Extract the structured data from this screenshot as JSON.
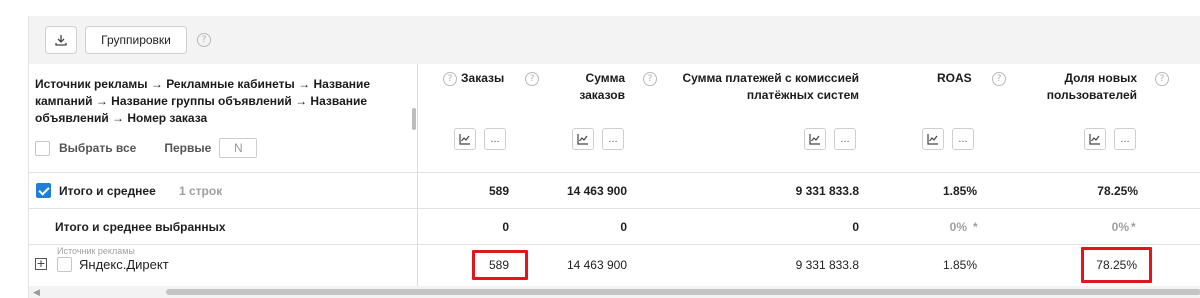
{
  "toolbar": {
    "download_icon": "download-icon",
    "grouping_label": "Группировки",
    "help_glyph": "?"
  },
  "header": {
    "first_column_title": "Источник рекламы → Рекламные кабинеты → Название кампаний → Название группы объявлений → Название объявлений → Номер заказа",
    "select_all_label": "Выбрать все",
    "first_label": "Первые",
    "first_placeholder": "N",
    "columns": [
      {
        "title": "Заказы",
        "key": "orders"
      },
      {
        "title": "Сумма заказов",
        "key": "orders_sum"
      },
      {
        "title": "Сумма платежей с комиссией платёжных систем",
        "key": "payments_sum"
      },
      {
        "title": "ROAS",
        "key": "roas"
      },
      {
        "title": "Доля новых пользователей",
        "key": "new_users_share"
      }
    ],
    "chart_icon": "line-chart-icon",
    "more_glyph": "..."
  },
  "rows": {
    "total": {
      "label": "Итого и среднее",
      "count": "1 строк",
      "orders": "589",
      "orders_sum": "14 463 900",
      "payments_sum": "9 331 833.8",
      "roas": "1.85%",
      "new_users_share": "78.25%"
    },
    "selected_total": {
      "label": "Итого и среднее выбранных",
      "orders": "0",
      "orders_sum": "0",
      "payments_sum": "0",
      "roas": "0%",
      "roas_marker": "*",
      "new_users_share": "0%",
      "new_users_marker": "*"
    },
    "item": {
      "group_caption": "Источник рекламы",
      "expand_glyph": "+",
      "label": "Яндекс.Директ",
      "orders": "589",
      "orders_sum": "14 463 900",
      "payments_sum": "9 331 833.8",
      "roas": "1.85%",
      "new_users_share": "78.25%"
    }
  },
  "colors": {
    "accent": "#1f7fd6",
    "highlight": "#e0161c"
  }
}
